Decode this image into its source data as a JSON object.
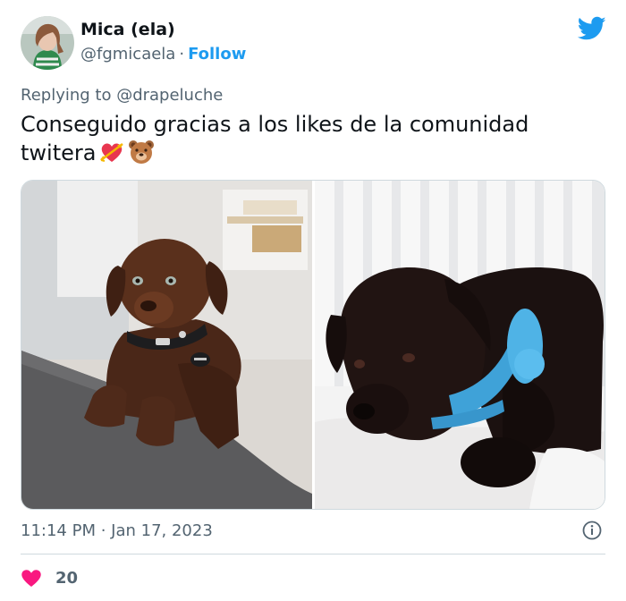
{
  "author": {
    "name": "Mica (ela)",
    "handle": "@fgmicaela",
    "separator": "·",
    "follow_label": "Follow"
  },
  "tweet": {
    "replying_to": "Replying to @drapeluche",
    "text": "Conseguido gracias a los likes de la comunidad twitera",
    "emojis": [
      "heart-arrow-icon",
      "bear-face-icon"
    ],
    "timestamp": "11:14 PM · Jan 17, 2023"
  },
  "engagement": {
    "likes": "20"
  },
  "colors": {
    "brand": "#1d9bf0",
    "like": "#f91880",
    "secondary_text": "#536471"
  }
}
